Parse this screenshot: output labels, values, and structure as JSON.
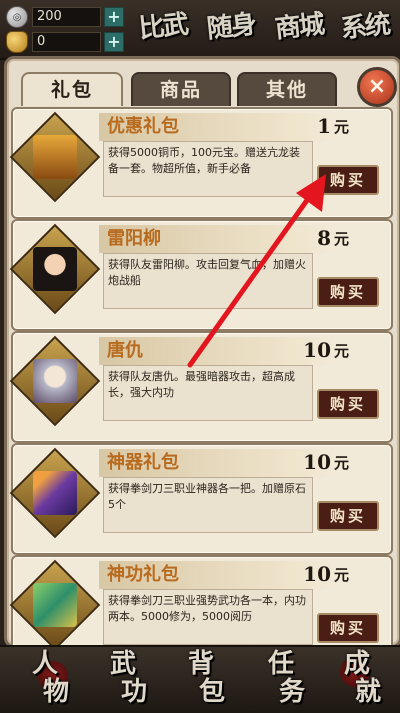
{
  "currency": {
    "silver": {
      "icon": "silver-coin-icon",
      "value": "200"
    },
    "gold": {
      "icon": "gold-ingot-icon",
      "value": "0"
    }
  },
  "top_nav": [
    "比武",
    "随身",
    "商城",
    "系统"
  ],
  "tabs": [
    "礼包",
    "商品",
    "其他"
  ],
  "close_label": "×",
  "items": [
    {
      "name": "优惠礼包",
      "price": "1",
      "unit": "元",
      "desc": "获得5000铜币，100元宝。赠送亢龙装备一套。物超所值，新手必备",
      "buy": "购买",
      "icon": "treasure-chest-icon"
    },
    {
      "name": "雷阳柳",
      "price": "8",
      "unit": "元",
      "desc": "获得队友雷阳柳。攻击回复气血，加赠火炮战船",
      "buy": "购买",
      "icon": "hero-portrait-icon"
    },
    {
      "name": "唐仇",
      "price": "10",
      "unit": "元",
      "desc": "获得队友唐仇。最强暗器攻击，超高成长，强大内功",
      "buy": "购买",
      "icon": "hero-portrait-icon"
    },
    {
      "name": "神器礼包",
      "price": "10",
      "unit": "元",
      "desc": "获得拳剑刀三职业神器各一把。加赠原石5个",
      "buy": "购买",
      "icon": "artifact-weapon-icon"
    },
    {
      "name": "神功礼包",
      "price": "10",
      "unit": "元",
      "desc": "获得拳剑刀三职业强势武功各一本，内功两本。5000修为，5000阅历",
      "buy": "购买",
      "icon": "scroll-book-icon"
    }
  ],
  "bottom_nav": [
    {
      "c1": "人",
      "c2": "物"
    },
    {
      "c1": "武",
      "c2": "功"
    },
    {
      "c1": "背",
      "c2": "包"
    },
    {
      "c1": "任",
      "c2": "务"
    },
    {
      "c1": "成",
      "c2": "就"
    }
  ],
  "colors": {
    "annotation_arrow": "#e3161f",
    "item_name": "#b86b1e",
    "buy_button": "#4a1e15"
  }
}
